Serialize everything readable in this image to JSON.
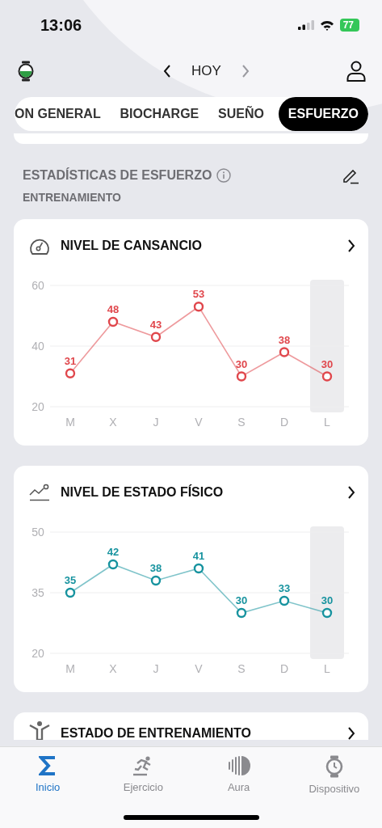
{
  "status_bar": {
    "time": "13:06",
    "battery": "77"
  },
  "header": {
    "title": "HOY",
    "prev_disabled": false,
    "next_disabled": true
  },
  "tabs": [
    {
      "label": "ON GENERAL",
      "selected": false
    },
    {
      "label": "BIOCHARGE",
      "selected": false
    },
    {
      "label": "SUEÑO",
      "selected": false
    },
    {
      "label": "ESFUERZO",
      "selected": true
    }
  ],
  "section": {
    "title": "ESTADÍSTICAS DE ESFUERZO",
    "subtitle": "ENTRENAMIENTO"
  },
  "cards": [
    {
      "kind": "gauge",
      "title": "NIVEL DE CANSANCIO",
      "chart_data": {
        "type": "line",
        "categories": [
          "M",
          "X",
          "J",
          "V",
          "S",
          "D",
          "L"
        ],
        "series": [
          {
            "color": "#e0474c",
            "marker": "circle",
            "values": [
              31,
              48,
              43,
              53,
              30,
              38,
              30
            ]
          }
        ],
        "ylim": [
          20,
          60
        ],
        "yticks": [
          20,
          40,
          60
        ],
        "data_labels": true
      }
    },
    {
      "kind": "trend",
      "title": "NIVEL DE ESTADO FÍSICO",
      "chart_data": {
        "type": "line",
        "categories": [
          "M",
          "X",
          "J",
          "V",
          "S",
          "D",
          "L"
        ],
        "series": [
          {
            "color": "#17939f",
            "marker": "circle",
            "values": [
              35,
              42,
              38,
              41,
              30,
              33,
              30
            ]
          }
        ],
        "ylim": [
          20,
          50
        ],
        "yticks": [
          20,
          35,
          50
        ],
        "data_labels": true
      }
    },
    {
      "kind": "figure",
      "title": "ESTADO DE ENTRENAMIENTO"
    }
  ],
  "tab_bar": [
    {
      "kind": "sigma",
      "label": "Inicio",
      "selected": true
    },
    {
      "kind": "runner",
      "label": "Ejercicio",
      "selected": false
    },
    {
      "kind": "aura",
      "label": "Aura",
      "selected": false
    },
    {
      "kind": "watch",
      "label": "Dispositivo",
      "selected": false
    }
  ]
}
